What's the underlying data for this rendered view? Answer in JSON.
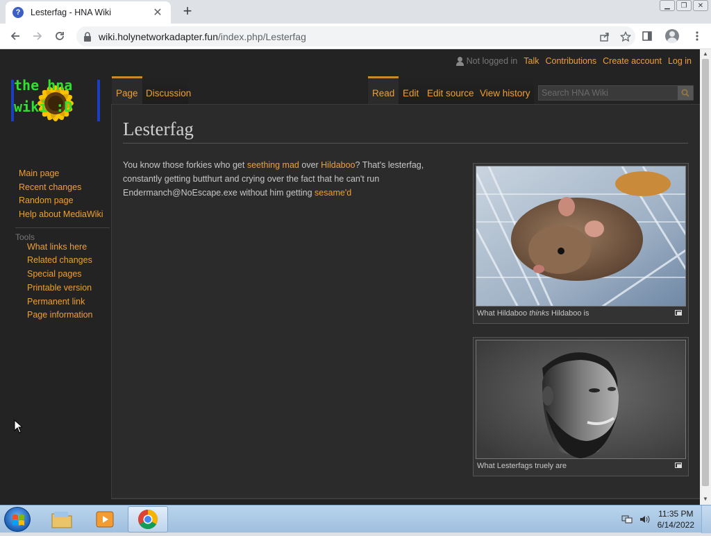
{
  "browser": {
    "tab_title": "Lesterfag - HNA Wiki",
    "tab_favicon": "?",
    "url_host": "wiki.holynetworkadapter.fun",
    "url_path": "/index.php/Lesterfag"
  },
  "wiki": {
    "logo_text": "the hna wiki :D",
    "personal": {
      "not_logged_in": "Not logged in",
      "talk": "Talk",
      "contributions": "Contributions",
      "create_account": "Create account",
      "log_in": "Log in"
    },
    "tabs": {
      "page": "Page",
      "discussion": "Discussion",
      "read": "Read",
      "edit": "Edit",
      "edit_source": "Edit source",
      "view_history": "View history"
    },
    "search_placeholder": "Search HNA Wiki",
    "title": "Lesterfag",
    "body": {
      "t1": "You know those forkies who get ",
      "l1": "seething mad",
      "t2": " over ",
      "l2": "Hildaboo",
      "t3": "? That's lesterfag, constantly getting butthurt and crying over the fact that he can't run Endermanch@NoEscape.exe without him getting ",
      "l3": "sesame'd"
    },
    "figures": [
      {
        "caption_a": "What Hildaboo ",
        "caption_em": "thinks",
        "caption_b": " Hildaboo is"
      },
      {
        "caption": "What Lesterfags truely are"
      }
    ],
    "navigation": [
      "Main page",
      "Recent changes",
      "Random page",
      "Help about MediaWiki"
    ],
    "tools_heading": "Tools",
    "tools": [
      "What links here",
      "Related changes",
      "Special pages",
      "Printable version",
      "Permanent link",
      "Page information"
    ]
  },
  "taskbar": {
    "time": "11:35 PM",
    "date": "6/14/2022"
  },
  "colors": {
    "link": "#f0a030",
    "page_bg": "#232323",
    "content_bg": "#2b2b2b"
  }
}
